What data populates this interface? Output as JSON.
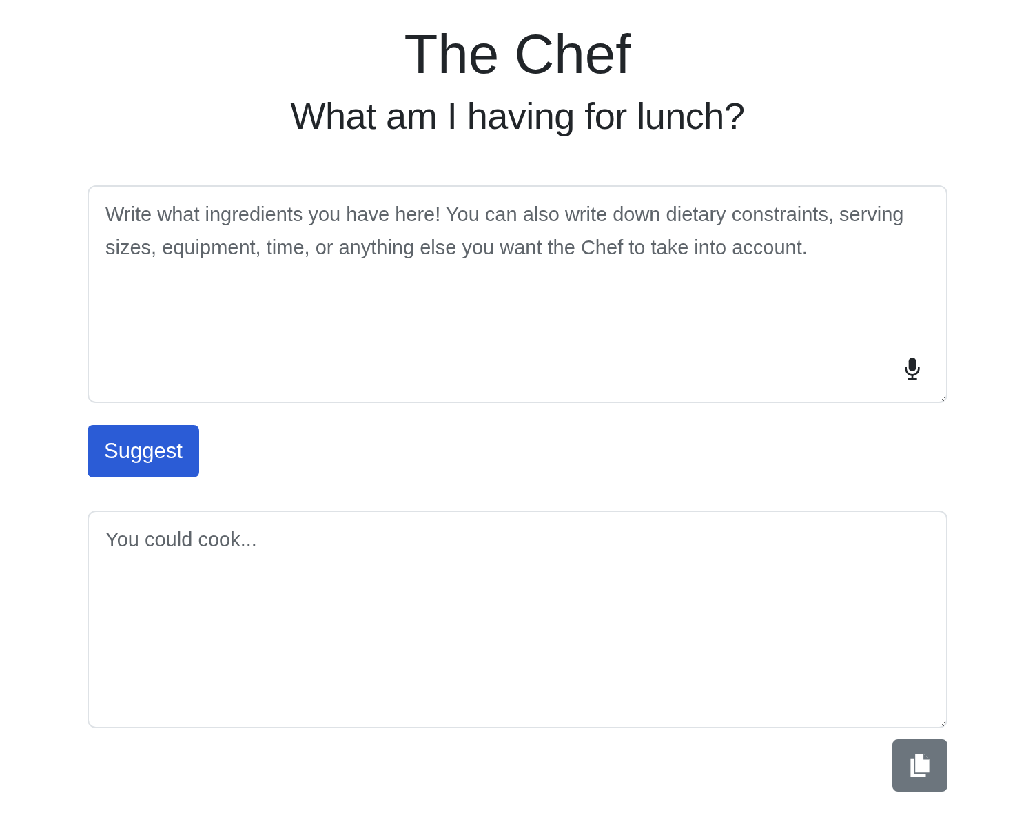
{
  "title": "The Chef",
  "subtitle": "What am I having for lunch?",
  "ingredients": {
    "placeholder": "Write what ingredients you have here! You can also write down dietary constraints, serving sizes, equipment, time, or anything else you want the Chef to take into account."
  },
  "suggest_button": "Suggest",
  "result": {
    "placeholder": "You could cook..."
  }
}
